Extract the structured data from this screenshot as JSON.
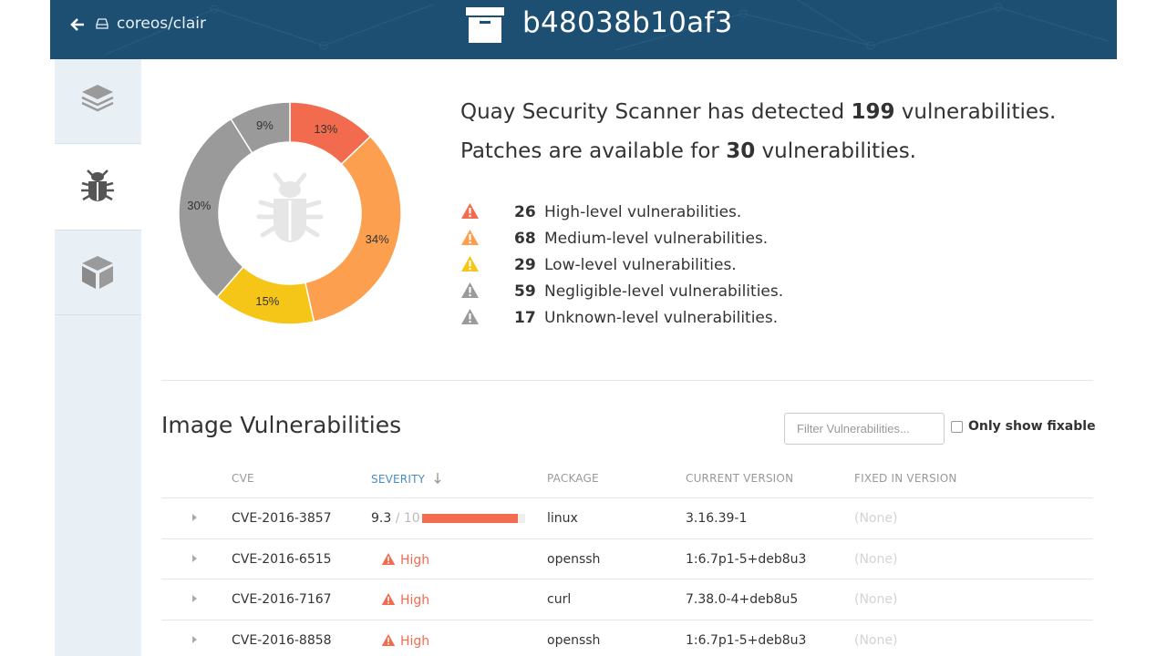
{
  "header": {
    "back_icon": "arrow-left-icon",
    "repo_icon": "hdd-icon",
    "repo": "coreos/clair",
    "title_icon": "archive-box-icon",
    "title": "b48038b10af3"
  },
  "sidebar": {
    "tabs": [
      {
        "icon": "layers-icon",
        "active": false
      },
      {
        "icon": "bug-icon",
        "active": true
      },
      {
        "icon": "package-icon",
        "active": false
      }
    ]
  },
  "summary": {
    "line1_prefix": "Quay Security Scanner has detected ",
    "line1_count": "199",
    "line1_suffix": " vulnerabilities.",
    "line2_prefix": "Patches are available for ",
    "line2_count": "30",
    "line2_suffix": " vulnerabilities."
  },
  "severity_breakdown": [
    {
      "count": "26",
      "label": "High-level vulnerabilities.",
      "color": "#f26b4f"
    },
    {
      "count": "68",
      "label": "Medium-level vulnerabilities.",
      "color": "#fca04f"
    },
    {
      "count": "29",
      "label": "Low-level vulnerabilities.",
      "color": "#f5c518"
    },
    {
      "count": "59",
      "label": "Negligible-level vulnerabilities.",
      "color": "#9a9a9a"
    },
    {
      "count": "17",
      "label": "Unknown-level vulnerabilities.",
      "color": "#9a9a9a"
    }
  ],
  "chart_data": {
    "type": "pie",
    "title": "",
    "categories": [
      "High",
      "Medium",
      "Low",
      "Negligible",
      "Unknown"
    ],
    "values": [
      13,
      34,
      15,
      30,
      9
    ],
    "labels": [
      "13%",
      "34%",
      "15%",
      "30%",
      "9%"
    ],
    "colors": [
      "#f26b4f",
      "#fca04f",
      "#f5c518",
      "#9a9a9a",
      "#9a9a9a"
    ],
    "center_icon": "bug-icon"
  },
  "vulnerabilities": {
    "title": "Image Vulnerabilities",
    "filter_placeholder": "Filter Vulnerabilities...",
    "only_fixable_label": "Only show fixable",
    "only_fixable_checked": false,
    "columns": {
      "cve": "CVE",
      "severity": "SEVERITY",
      "package": "PACKAGE",
      "current_version": "CURRENT VERSION",
      "fixed_in_version": "FIXED IN VERSION"
    },
    "sort_icon": "arrow-down-icon",
    "rows": [
      {
        "cve": "CVE-2016-3857",
        "score": "9.3",
        "score_max": " / 10",
        "score_value": 0.93,
        "package": "linux",
        "current_version": "3.16.39-1",
        "fixed_in_version": "(None)"
      },
      {
        "cve": "CVE-2016-6515",
        "severity": "High",
        "package": "openssh",
        "current_version": "1:6.7p1-5+deb8u3",
        "fixed_in_version": "(None)"
      },
      {
        "cve": "CVE-2016-7167",
        "severity": "High",
        "package": "curl",
        "current_version": "7.38.0-4+deb8u5",
        "fixed_in_version": "(None)"
      },
      {
        "cve": "CVE-2016-8858",
        "severity": "High",
        "package": "openssh",
        "current_version": "1:6.7p1-5+deb8u3",
        "fixed_in_version": "(None)"
      }
    ]
  }
}
